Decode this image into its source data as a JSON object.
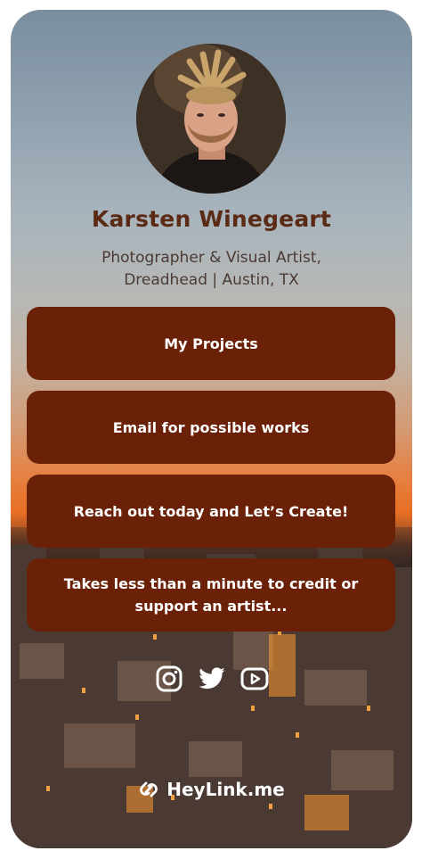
{
  "profile": {
    "name": "Karsten Winegeart",
    "bio_line1": "Photographer & Visual Artist,",
    "bio_line2": "Dreadhead | Austin, TX"
  },
  "links": [
    {
      "label": "My Projects"
    },
    {
      "label": "Email for possible works"
    },
    {
      "label": "Reach out today and Let’s Create!"
    },
    {
      "label": "Takes less than a minute to credit or support an artist..."
    }
  ],
  "socials": [
    {
      "icon": "instagram-icon"
    },
    {
      "icon": "twitter-icon"
    },
    {
      "icon": "youtube-icon"
    }
  ],
  "footer": {
    "brand": "HeyLink.me",
    "icon": "heylink-logo-icon"
  },
  "colors": {
    "button_bg": "#6b2107",
    "name_text": "#5a2a14",
    "bio_text": "#4a3a33",
    "accent_sunset": "#e76f24"
  }
}
